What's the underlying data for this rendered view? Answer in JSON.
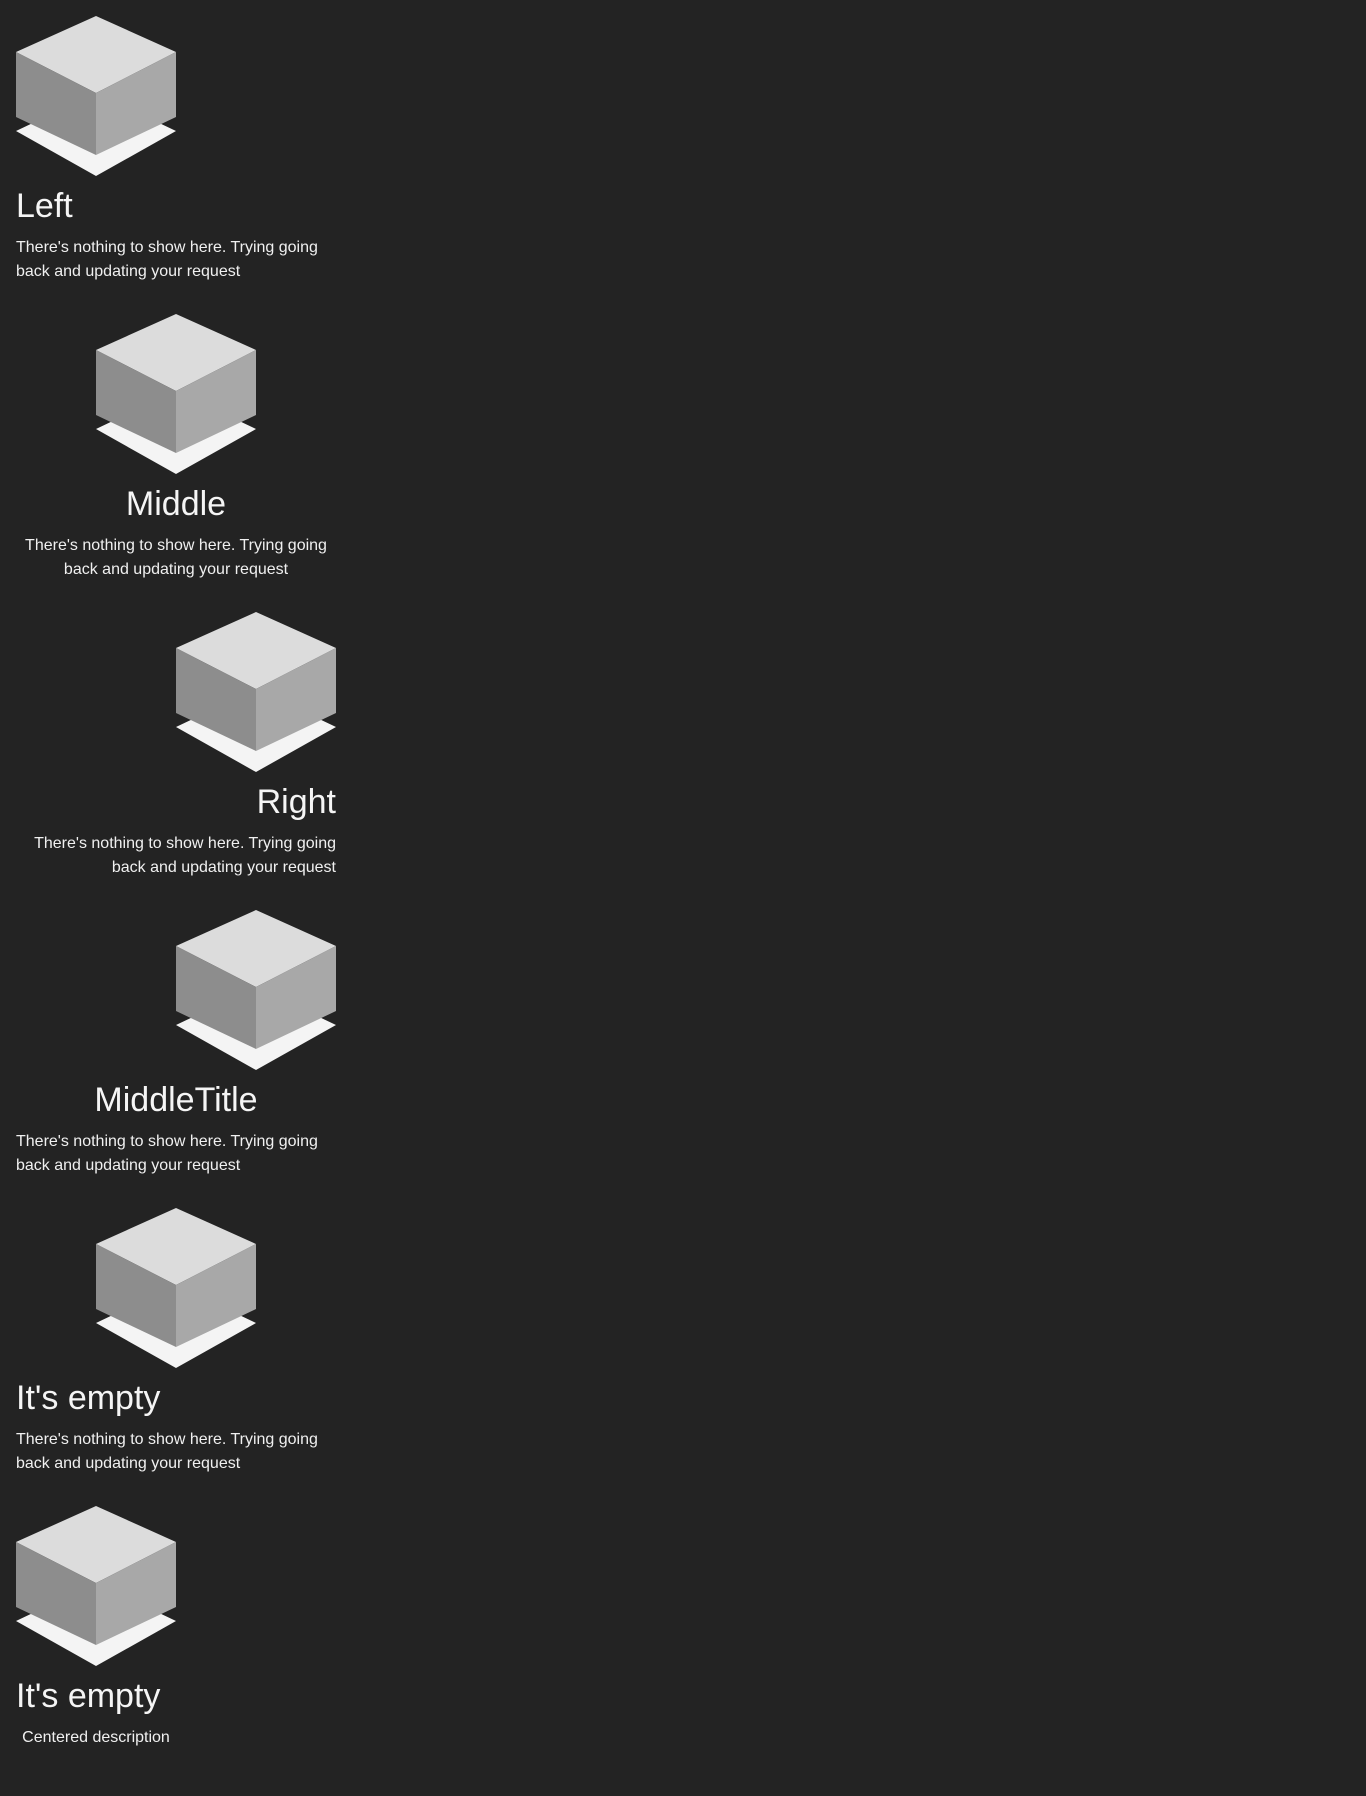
{
  "states": [
    {
      "title": "Left",
      "description": "There's nothing to show here. Trying going back and updating your request"
    },
    {
      "title": "Middle",
      "description": "There's nothing to show here. Trying going back and updating your request"
    },
    {
      "title": "Right",
      "description": "There's nothing to show here. Trying going back and updating your request"
    },
    {
      "title": "MiddleTitle",
      "description": "There's nothing to show here. Trying going back and updating your request"
    },
    {
      "title": "It's empty",
      "description": "There's nothing to show here. Trying going back and updating your request"
    },
    {
      "title": "It's empty",
      "description": "Centered description"
    }
  ],
  "icon": "empty-box-icon",
  "colors": {
    "background": "#232323",
    "text": "#f2f2f2",
    "box_top": "#dcdcdc",
    "box_left": "#8d8d8d",
    "box_right": "#a8a8a8",
    "box_shadow": "#f4f4f4"
  }
}
